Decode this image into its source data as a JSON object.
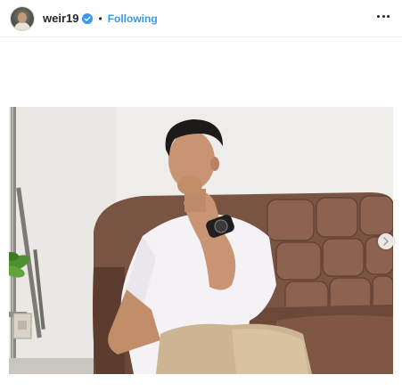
{
  "post": {
    "username": "weir19",
    "separator": "•",
    "follow_status": "Following"
  },
  "icons": {
    "verified": "verified-badge-icon",
    "more": "more-options-icon",
    "next": "chevron-right-icon"
  },
  "colors": {
    "link_blue": "#3897f0",
    "text": "#262626",
    "divider": "#efefef"
  }
}
